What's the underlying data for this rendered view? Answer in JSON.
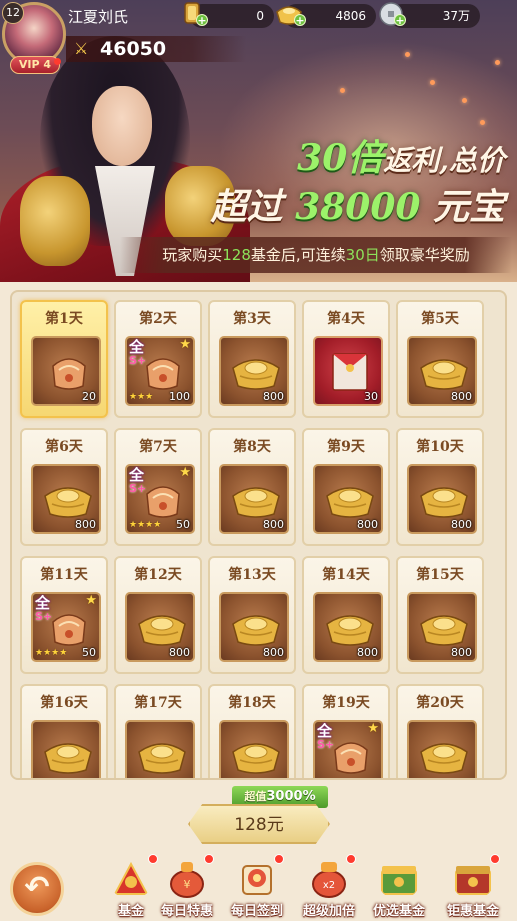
{
  "player": {
    "level": "12",
    "name": "江夏刘氏",
    "vip_label": "VIP 4",
    "power": "46050"
  },
  "resources": [
    {
      "name": "token",
      "icon": "token-icon",
      "value": "0"
    },
    {
      "name": "ingot",
      "icon": "gold-ingot-icon",
      "value": "4806"
    },
    {
      "name": "coin",
      "icon": "silver-coin-icon",
      "value": "37万"
    }
  ],
  "banner": {
    "headline_num": "30倍",
    "headline_a": "返利,总价",
    "headline_b": "超过",
    "headline_num2": "38000",
    "headline_c": "元宝",
    "sub_pre": "玩家购买",
    "sub_num": "128",
    "sub_mid": "基金后,可连续",
    "sub_days": "30日",
    "sub_post": "领取豪华奖励"
  },
  "days": [
    {
      "label": "第1天",
      "item": "equipment",
      "qty": "20",
      "active": true,
      "tags": false
    },
    {
      "label": "第2天",
      "item": "equipment",
      "qty": "100",
      "stars": "★★★",
      "tags": true
    },
    {
      "label": "第3天",
      "item": "ingot",
      "qty": "800"
    },
    {
      "label": "第4天",
      "item": "red-envelope",
      "qty": "30"
    },
    {
      "label": "第5天",
      "item": "ingot",
      "qty": "800"
    },
    {
      "label": "第6天",
      "item": "ingot",
      "qty": "800"
    },
    {
      "label": "第7天",
      "item": "equipment",
      "qty": "50",
      "stars": "★★★★",
      "tags": true
    },
    {
      "label": "第8天",
      "item": "ingot",
      "qty": "800"
    },
    {
      "label": "第9天",
      "item": "ingot",
      "qty": "800"
    },
    {
      "label": "第10天",
      "item": "ingot",
      "qty": "800"
    },
    {
      "label": "第11天",
      "item": "equipment",
      "qty": "50",
      "stars": "★★★★",
      "tags": true
    },
    {
      "label": "第12天",
      "item": "ingot",
      "qty": "800"
    },
    {
      "label": "第13天",
      "item": "ingot",
      "qty": "800"
    },
    {
      "label": "第14天",
      "item": "ingot",
      "qty": "800"
    },
    {
      "label": "第15天",
      "item": "ingot",
      "qty": "800"
    },
    {
      "label": "第16天",
      "item": "ingot",
      "qty": ""
    },
    {
      "label": "第17天",
      "item": "ingot",
      "qty": ""
    },
    {
      "label": "第18天",
      "item": "ingot",
      "qty": ""
    },
    {
      "label": "第19天",
      "item": "equipment",
      "qty": "",
      "tags": true
    },
    {
      "label": "第20天",
      "item": "ingot",
      "qty": ""
    }
  ],
  "tag_text": {
    "quan": "全",
    "splus": "S+"
  },
  "buy": {
    "tag_pre": "超值",
    "tag_value": "3000%",
    "price": "128元"
  },
  "nav": [
    {
      "label": "基金",
      "icon": "fund-icon"
    },
    {
      "label": "每日特惠",
      "icon": "daily-deal-icon"
    },
    {
      "label": "每日签到",
      "icon": "daily-checkin-icon"
    },
    {
      "label": "超级加倍",
      "icon": "super-double-icon"
    },
    {
      "label": "优选基金",
      "icon": "premium-fund-icon"
    },
    {
      "label": "钜惠基金",
      "icon": "mega-fund-icon"
    }
  ],
  "colors": {
    "accent_green": "#9cf26a",
    "gold": "#f3c24c",
    "card_bg": "#fbf5e8",
    "brown_text": "#7a4a22"
  }
}
